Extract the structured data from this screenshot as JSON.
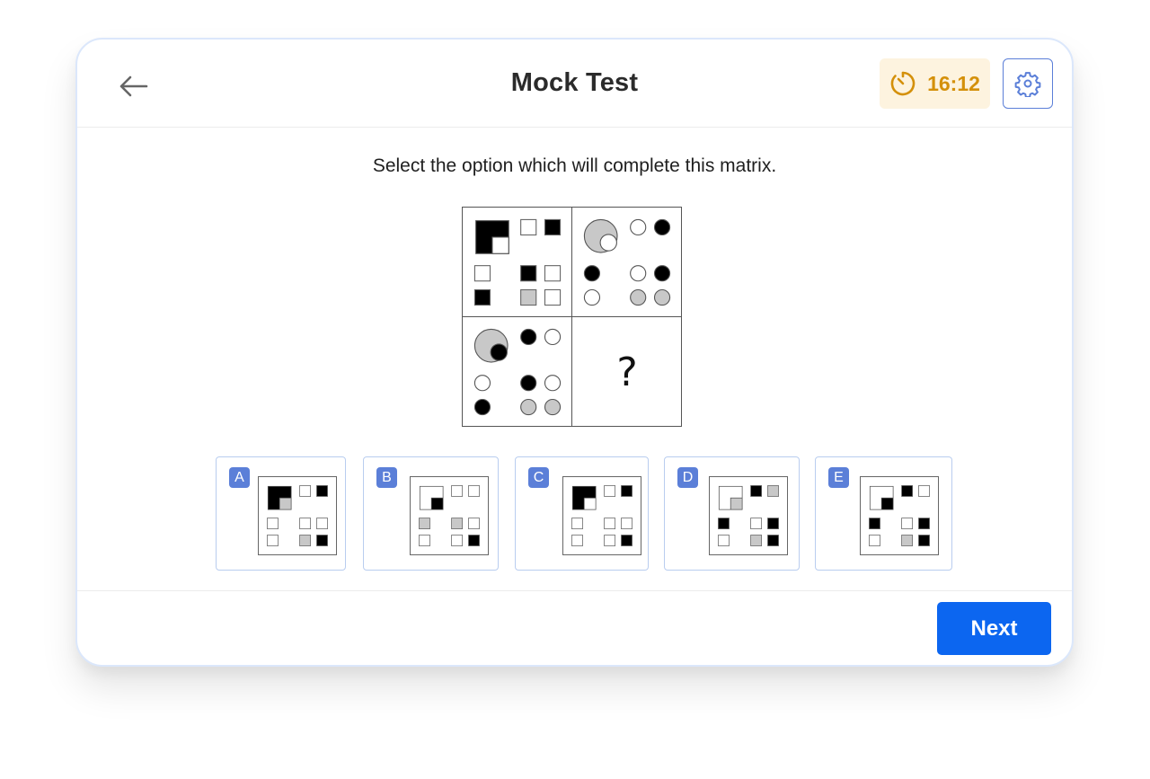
{
  "header": {
    "title": "Mock Test",
    "back_icon": "arrow-left-icon",
    "timer": {
      "icon": "timer-icon",
      "value": "16:12",
      "color": "#d4900a",
      "bg": "#fdf3df"
    },
    "settings_icon": "gear-icon"
  },
  "question": {
    "text": "Select the option which will complete this matrix."
  },
  "matrix": {
    "missing_symbol": "?",
    "cells": [
      {
        "shape": "square",
        "big": {
          "fill": "black",
          "inner_fill": "white"
        },
        "top": [
          "white",
          "black"
        ],
        "grid": [
          [
            "white",
            null,
            "black",
            "white"
          ],
          [
            "black",
            null,
            "gray",
            "white"
          ]
        ]
      },
      {
        "shape": "circle",
        "big": {
          "fill": "gray",
          "inner_fill": "white"
        },
        "top": [
          "white",
          "black"
        ],
        "grid": [
          [
            "black",
            null,
            "white",
            "black"
          ],
          [
            "white",
            null,
            "gray",
            "gray"
          ]
        ]
      },
      {
        "shape": "circle",
        "big": {
          "fill": "gray",
          "inner_fill": "black"
        },
        "top": [
          "black",
          "white"
        ],
        "grid": [
          [
            "white",
            null,
            "black",
            "white"
          ],
          [
            "black",
            null,
            "gray",
            "gray"
          ]
        ]
      }
    ]
  },
  "options": [
    {
      "label": "A",
      "figure": {
        "shape": "square",
        "big": {
          "fill": "black",
          "inner_fill": "gray"
        },
        "top": [
          "white",
          "black"
        ],
        "grid": [
          [
            "white",
            null,
            "white",
            "white"
          ],
          [
            "white",
            null,
            "gray",
            "black"
          ]
        ]
      }
    },
    {
      "label": "B",
      "figure": {
        "shape": "square",
        "big": {
          "fill": "white",
          "inner_fill": "black"
        },
        "top": [
          "white",
          "white"
        ],
        "grid": [
          [
            "gray",
            null,
            "gray",
            "white"
          ],
          [
            "white",
            null,
            "white",
            "black"
          ]
        ]
      }
    },
    {
      "label": "C",
      "figure": {
        "shape": "square",
        "big": {
          "fill": "black",
          "inner_fill": "white"
        },
        "top": [
          "white",
          "black"
        ],
        "grid": [
          [
            "white",
            null,
            "white",
            "white"
          ],
          [
            "white",
            null,
            "white",
            "black"
          ]
        ]
      }
    },
    {
      "label": "D",
      "figure": {
        "shape": "square",
        "big": {
          "fill": "white",
          "inner_fill": "gray"
        },
        "top": [
          "black",
          "gray"
        ],
        "grid": [
          [
            "black",
            null,
            "white",
            "black"
          ],
          [
            "white",
            null,
            "gray",
            "black"
          ]
        ]
      }
    },
    {
      "label": "E",
      "figure": {
        "shape": "square",
        "big": {
          "fill": "white",
          "inner_fill": "black"
        },
        "top": [
          "black",
          "white"
        ],
        "grid": [
          [
            "black",
            null,
            "white",
            "black"
          ],
          [
            "white",
            null,
            "gray",
            "black"
          ]
        ]
      }
    }
  ],
  "footer": {
    "next_label": "Next"
  },
  "colors": {
    "accent": "#0c66f0",
    "badge": "#5b7fd8",
    "option_border": "#b9cdef",
    "gray_fill": "#c8c8c8"
  }
}
